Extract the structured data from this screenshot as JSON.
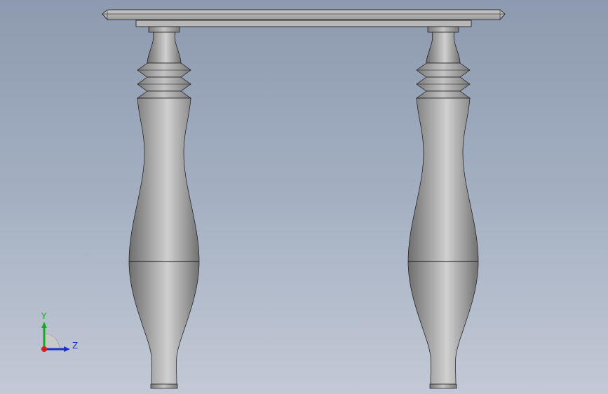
{
  "viewport": {
    "background_top": "#8d9aaf",
    "background_bottom": "#c3c9d6"
  },
  "model": {
    "part_color": "#a9a9a9",
    "edge_color": "#1a1a1a"
  },
  "triad": {
    "y_label": "Y",
    "z_label": "Z",
    "y_color": "#1fa52b",
    "z_color": "#1c2fd1",
    "x_color": "#d81e1e"
  }
}
